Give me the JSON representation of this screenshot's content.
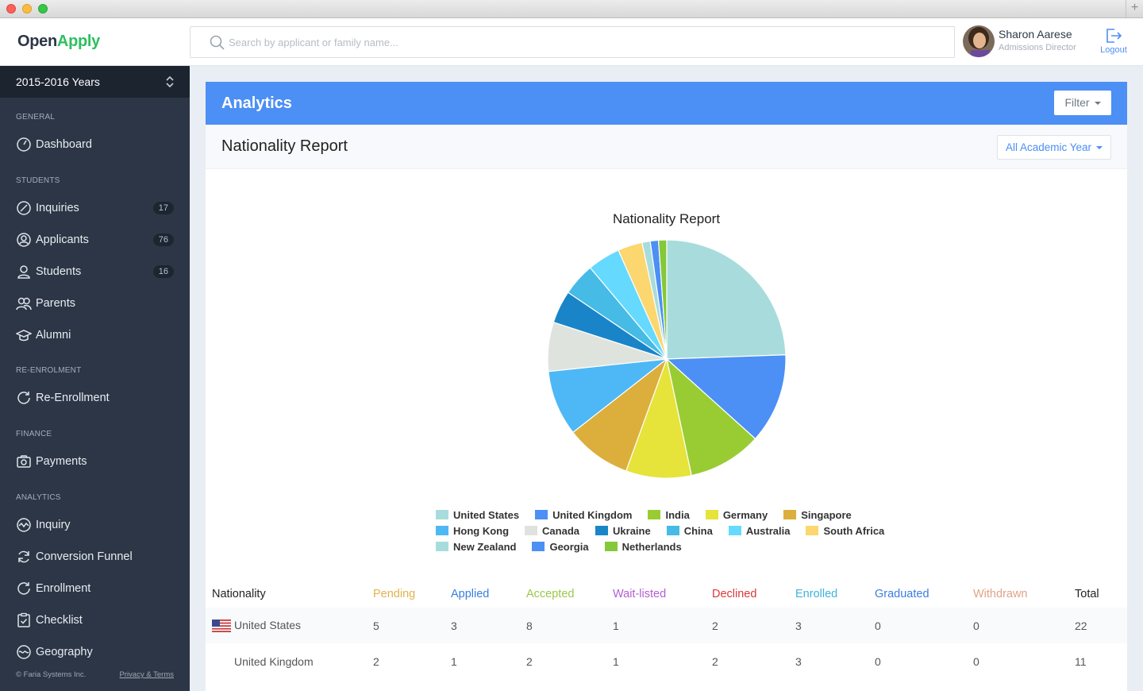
{
  "window": {
    "plus_label": "+"
  },
  "brand": {
    "part1": "Open",
    "part2": "Apply"
  },
  "search": {
    "placeholder": "Search by applicant or family name..."
  },
  "user": {
    "name": "Sharon Aarese",
    "role": "Admissions Director",
    "logout_label": "Logout"
  },
  "sidebar": {
    "year_selector": "2015-2016 Years",
    "sections": {
      "general": "GENERAL",
      "students": "STUDENTS",
      "reenrolment": "RE-ENROLMENT",
      "finance": "FINANCE",
      "analytics": "ANALYTICS"
    },
    "items": {
      "dashboard": "Dashboard",
      "inquiries": "Inquiries",
      "inquiries_count": "17",
      "applicants": "Applicants",
      "applicants_count": "76",
      "students": "Students",
      "students_count": "16",
      "parents": "Parents",
      "alumni": "Alumni",
      "reenrollment": "Re-Enrollment",
      "payments": "Payments",
      "inquiry": "Inquiry",
      "conversion_funnel": "Conversion Funnel",
      "enrollment": "Enrollment",
      "checklist": "Checklist",
      "geography": "Geography"
    },
    "footer": {
      "copyright": "© Faria Systems Inc.",
      "privacy": "Privacy & Terms"
    }
  },
  "panel": {
    "title": "Analytics",
    "filter_label": "Filter",
    "report_title": "Nationality Report",
    "year_filter": "All Academic Year"
  },
  "chart_data": {
    "type": "pie",
    "title": "Nationality Report",
    "legend_position": "bottom",
    "series": [
      {
        "name": "United States",
        "value": 22,
        "color": "#a8dcdc"
      },
      {
        "name": "United Kingdom",
        "value": 11,
        "color": "#4c8ff5"
      },
      {
        "name": "India",
        "value": 9,
        "color": "#99cc33"
      },
      {
        "name": "Germany",
        "value": 8,
        "color": "#e6e33a"
      },
      {
        "name": "Singapore",
        "value": 8,
        "color": "#dcae3c"
      },
      {
        "name": "Hong Kong",
        "value": 8,
        "color": "#4db8f5"
      },
      {
        "name": "Canada",
        "value": 6,
        "color": "#dfe3de"
      },
      {
        "name": "Ukraine",
        "value": 4,
        "color": "#1985c8"
      },
      {
        "name": "China",
        "value": 4,
        "color": "#45bbe6"
      },
      {
        "name": "Australia",
        "value": 4,
        "color": "#66d9ff"
      },
      {
        "name": "South Africa",
        "value": 3,
        "color": "#fcd66e"
      },
      {
        "name": "New Zealand",
        "value": 1,
        "color": "#a8dcdc"
      },
      {
        "name": "Georgia",
        "value": 1,
        "color": "#4c8ff5"
      },
      {
        "name": "Netherlands",
        "value": 1,
        "color": "#85c83a"
      }
    ]
  },
  "table": {
    "headers": [
      {
        "label": "Nationality",
        "color": "#222222"
      },
      {
        "label": "Pending",
        "color": "#e3b24c"
      },
      {
        "label": "Applied",
        "color": "#3a7de0"
      },
      {
        "label": "Accepted",
        "color": "#9cc84a"
      },
      {
        "label": "Wait-listed",
        "color": "#b15fd1"
      },
      {
        "label": "Declined",
        "color": "#d9373a"
      },
      {
        "label": "Enrolled",
        "color": "#3cb4dc"
      },
      {
        "label": "Graduated",
        "color": "#3a7de0"
      },
      {
        "label": "Withdrawn",
        "color": "#e0a388"
      },
      {
        "label": "Total",
        "color": "#222222"
      }
    ],
    "rows": [
      {
        "nationality": "United States",
        "flag": "us-flag-icon",
        "cells": [
          "5",
          "3",
          "8",
          "1",
          "2",
          "3",
          "0",
          "0",
          "22"
        ]
      },
      {
        "nationality": "United Kingdom",
        "flag": "",
        "cells": [
          "2",
          "1",
          "2",
          "1",
          "2",
          "3",
          "0",
          "0",
          "11"
        ]
      }
    ]
  }
}
